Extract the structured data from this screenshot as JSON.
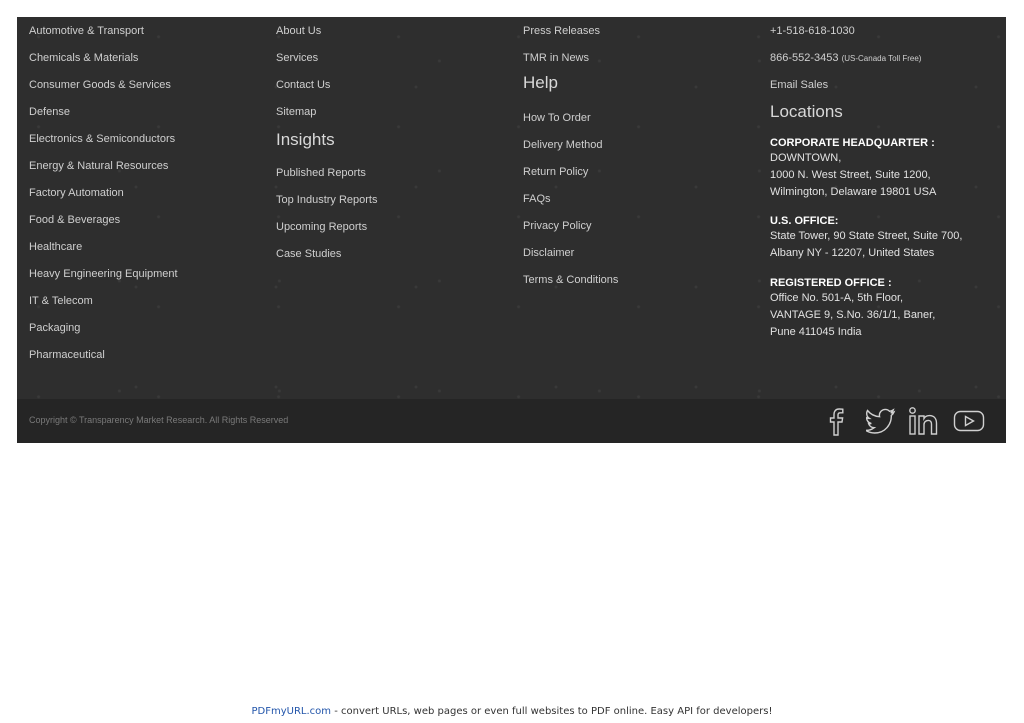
{
  "industries": [
    "Automotive & Transport",
    "Chemicals & Materials",
    "Consumer Goods & Services",
    "Defense",
    "Electronics & Semiconductors",
    "Energy & Natural Resources",
    "Factory Automation",
    "Food & Beverages",
    "Healthcare",
    "Heavy Engineering Equipment",
    "IT & Telecom",
    "Packaging",
    "Pharmaceutical"
  ],
  "company": [
    "About Us",
    "Services",
    "Contact Us",
    "Sitemap"
  ],
  "insights": {
    "heading": "Insights",
    "items": [
      "Published Reports",
      "Top Industry Reports",
      "Upcoming Reports",
      "Case Studies"
    ]
  },
  "media": [
    "Press Releases",
    "TMR in News"
  ],
  "help": {
    "heading": "Help",
    "items": [
      "How To Order",
      "Delivery Method",
      "Return Policy",
      "FAQs",
      "Privacy Policy",
      "Disclaimer",
      "Terms & Conditions"
    ]
  },
  "contact": {
    "phone": "+1-518-618-1030",
    "tollfree": "866-552-3453",
    "tollfree_note": "(US-Canada Toll Free)",
    "email": "Email Sales"
  },
  "locations": {
    "heading": "Locations",
    "hq_title": "CORPORATE HEADQUARTER :",
    "hq_lines": [
      "DOWNTOWN,",
      "1000 N. West Street, Suite 1200,",
      "Wilmington, Delaware 19801 USA"
    ],
    "us_title": "U.S. OFFICE:",
    "us_lines": [
      "State Tower, 90 State Street, Suite 700,",
      "Albany NY - 12207, United States"
    ],
    "reg_title": "REGISTERED OFFICE :",
    "reg_lines": [
      "Office No. 501-A, 5th Floor,",
      "VANTAGE 9, S.No. 36/1/1, Baner,",
      "Pune 411045 India"
    ]
  },
  "copyright": "Copyright © Transparency Market Research. All Rights Reserved",
  "social": [
    "facebook-icon",
    "twitter-icon",
    "linkedin-icon",
    "youtube-icon"
  ],
  "pdf_note": {
    "brand": "PDFmyURL.com",
    "text": " - convert URLs, web pages or even full websites to PDF online. Easy API for developers!"
  }
}
